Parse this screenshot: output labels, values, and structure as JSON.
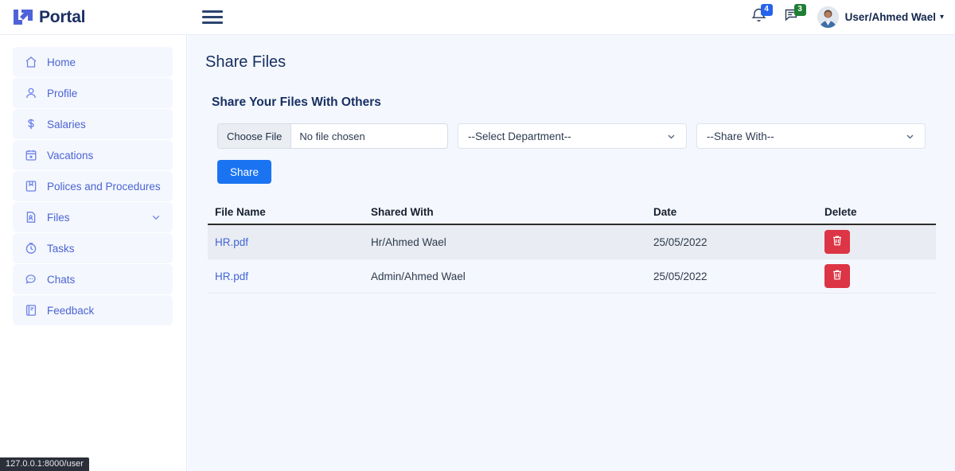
{
  "header": {
    "brand_name": "Portal",
    "brand_logo_icon": "l7-arrow-logo",
    "menu_icon": "hamburger-icon",
    "notifications": {
      "icon": "bell-icon",
      "count": "4",
      "color": "#2563eb"
    },
    "messages": {
      "icon": "message-square-icon",
      "count": "3",
      "color": "#1e7e34"
    },
    "user": {
      "name": "User/Ahmed Wael",
      "caret": "▾",
      "avatar_icon": "user-avatar"
    }
  },
  "sidebar": {
    "items": [
      {
        "label": "Home",
        "icon": "home-icon",
        "has_chevron": false
      },
      {
        "label": "Profile",
        "icon": "user-icon",
        "has_chevron": false
      },
      {
        "label": "Salaries",
        "icon": "dollar-icon",
        "has_chevron": false
      },
      {
        "label": "Vacations",
        "icon": "calendar-icon",
        "has_chevron": false
      },
      {
        "label": "Polices and Procedures",
        "icon": "book-icon",
        "has_chevron": false
      },
      {
        "label": "Files",
        "icon": "file-icon",
        "has_chevron": true
      },
      {
        "label": "Tasks",
        "icon": "clock-icon",
        "has_chevron": false
      },
      {
        "label": "Chats",
        "icon": "chat-bubble-icon",
        "has_chevron": false
      },
      {
        "label": "Feedback",
        "icon": "feedback-icon",
        "has_chevron": false
      }
    ]
  },
  "main": {
    "page_title": "Share Files",
    "section_title": "Share Your Files With Others",
    "form": {
      "file_button_label": "Choose File",
      "file_value": "No file chosen",
      "department_select": "--Select Department--",
      "share_with_select": "--Share With--",
      "submit_label": "Share"
    },
    "table": {
      "columns": [
        "File Name",
        "Shared With",
        "Date",
        "Delete"
      ],
      "rows": [
        {
          "file_name": "HR.pdf",
          "shared_with": "Hr/Ahmed Wael",
          "date": "25/05/2022",
          "delete_icon": "trash-icon"
        },
        {
          "file_name": "HR.pdf",
          "shared_with": "Admin/Ahmed Wael",
          "date": "25/05/2022",
          "delete_icon": "trash-icon"
        }
      ]
    }
  },
  "statusbar": {
    "url": "127.0.0.1:8000/user"
  },
  "colors": {
    "accent_blue": "#1a74f2",
    "nav_text": "#4b63d4",
    "nav_bg": "#f4f7fd",
    "danger_red": "#dc3545",
    "page_bg": "#f4f7fd",
    "title_navy": "#183063"
  }
}
